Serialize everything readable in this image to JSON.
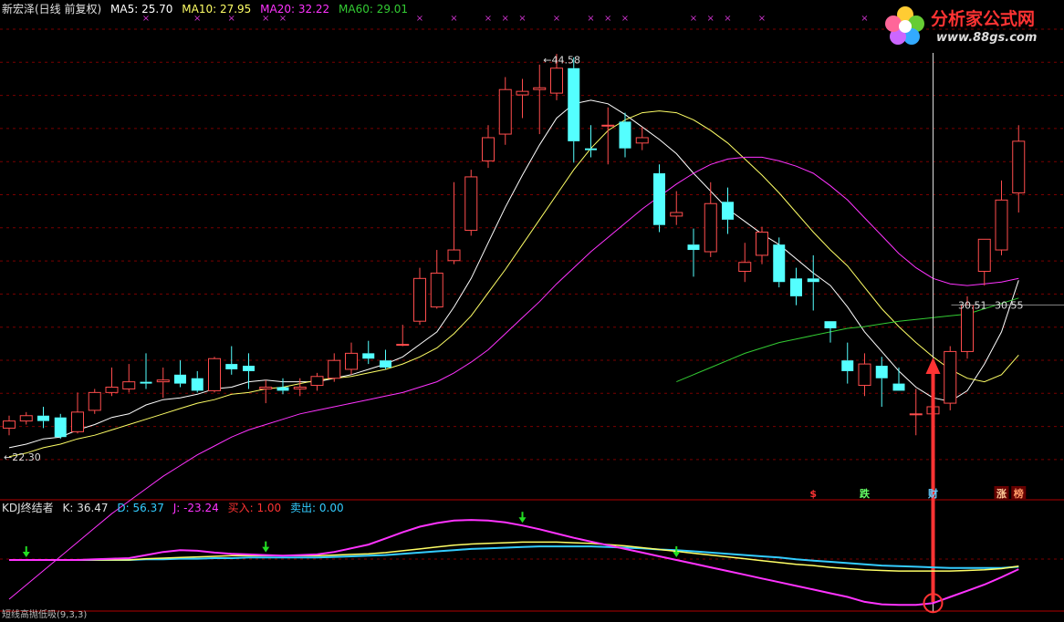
{
  "main_header": {
    "name": "新宏泽(日线 前复权)",
    "ma5": "MA5: 25.70",
    "ma10": "MA10: 27.95",
    "ma20": "MA20: 32.22",
    "ma60": "MA60: 29.01"
  },
  "kdj_header": {
    "name": "KDJ终结者",
    "k": "K: 36.47",
    "d": "D: 56.37",
    "j": "J: -23.24",
    "buy": "买入: 1.00",
    "sell": "卖出: 0.00"
  },
  "bottom_strip_text": "短线高抛低吸(9,3,3)",
  "logo": {
    "title": "分析家公式网",
    "url": "www.88gs.com"
  },
  "annotations": {
    "high": "44.58",
    "low": "22.30",
    "crosshair": "30.51",
    "price_label": "30.55"
  },
  "signal_labels": [
    "$",
    "跌",
    "财",
    "涨",
    "榜"
  ],
  "colors": {
    "bg": "#000000",
    "grid": "#7a0000",
    "up": "#ff4d4d",
    "down": "#54ffff",
    "ma5": "#ffffff",
    "ma10": "#ffff66",
    "ma20": "#ff33ff",
    "ma60": "#33cc33",
    "kdj_k": "#ffff66",
    "kdj_d": "#33ccff",
    "kdj_j": "#ff33ff",
    "arrow": "#ff3333"
  },
  "chart_data": {
    "type": "candlestick",
    "ohlc": [
      [
        23.6,
        24.3,
        23.2,
        24.0
      ],
      [
        24.0,
        24.5,
        23.8,
        24.3
      ],
      [
        24.3,
        24.8,
        23.6,
        24.0
      ],
      [
        24.2,
        24.4,
        23.0,
        23.1
      ],
      [
        23.4,
        25.6,
        23.3,
        24.5
      ],
      [
        24.6,
        25.8,
        24.4,
        25.6
      ],
      [
        25.6,
        27.0,
        25.4,
        25.9
      ],
      [
        25.8,
        27.2,
        25.6,
        26.2
      ],
      [
        26.2,
        27.8,
        25.8,
        26.1
      ],
      [
        26.2,
        27.0,
        25.3,
        26.3
      ],
      [
        26.6,
        27.4,
        25.9,
        26.1
      ],
      [
        26.4,
        26.8,
        25.6,
        25.7
      ],
      [
        25.7,
        27.6,
        25.6,
        27.5
      ],
      [
        27.2,
        28.2,
        26.6,
        26.9
      ],
      [
        27.1,
        27.8,
        25.8,
        26.8
      ],
      [
        25.8,
        26.3,
        25.0,
        25.9
      ],
      [
        25.9,
        26.4,
        25.5,
        25.7
      ],
      [
        25.8,
        26.4,
        25.4,
        25.9
      ],
      [
        26.0,
        26.7,
        25.7,
        26.5
      ],
      [
        26.4,
        27.8,
        26.2,
        27.4
      ],
      [
        26.9,
        28.4,
        26.6,
        27.8
      ],
      [
        27.8,
        28.5,
        27.2,
        27.5
      ],
      [
        27.4,
        28.0,
        26.9,
        27.0
      ],
      [
        28.3,
        29.4,
        28.2,
        28.3
      ],
      [
        29.6,
        32.6,
        29.4,
        32.0
      ],
      [
        30.4,
        33.6,
        30.3,
        32.3
      ],
      [
        33.0,
        37.4,
        32.8,
        33.6
      ],
      [
        34.7,
        38.1,
        34.4,
        37.7
      ],
      [
        38.6,
        40.6,
        38.2,
        39.9
      ],
      [
        40.1,
        43.3,
        39.5,
        42.6
      ],
      [
        42.3,
        43.2,
        41.0,
        42.5
      ],
      [
        42.6,
        44.0,
        40.1,
        42.7
      ],
      [
        42.4,
        44.6,
        42.0,
        43.8
      ],
      [
        43.8,
        44.4,
        38.5,
        39.7
      ],
      [
        39.3,
        40.6,
        38.8,
        39.2
      ],
      [
        40.6,
        41.6,
        38.4,
        40.6
      ],
      [
        40.8,
        41.3,
        38.8,
        39.3
      ],
      [
        39.6,
        40.5,
        39.2,
        39.9
      ],
      [
        37.9,
        38.4,
        34.6,
        35.0
      ],
      [
        35.5,
        36.9,
        35.0,
        35.7
      ],
      [
        33.9,
        34.8,
        32.1,
        33.6
      ],
      [
        33.5,
        37.4,
        33.2,
        36.2
      ],
      [
        36.3,
        37.1,
        34.5,
        35.3
      ],
      [
        32.4,
        34.0,
        31.8,
        32.9
      ],
      [
        33.3,
        34.9,
        32.8,
        34.6
      ],
      [
        33.9,
        34.3,
        31.5,
        31.8
      ],
      [
        32.0,
        32.6,
        30.5,
        31.0
      ],
      [
        32.0,
        33.3,
        30.2,
        31.8
      ],
      [
        29.6,
        29.6,
        28.4,
        29.2
      ],
      [
        27.4,
        28.4,
        26.1,
        26.8
      ],
      [
        26.0,
        27.8,
        25.4,
        27.2
      ],
      [
        27.1,
        27.6,
        24.8,
        26.4
      ],
      [
        26.1,
        27.0,
        25.7,
        25.7
      ],
      [
        24.4,
        25.8,
        23.2,
        24.4
      ],
      [
        24.4,
        25.6,
        24.2,
        24.8
      ],
      [
        25.0,
        28.2,
        24.6,
        27.9
      ],
      [
        27.9,
        31.0,
        27.5,
        30.5
      ],
      [
        32.4,
        34.2,
        31.6,
        34.2
      ],
      [
        33.6,
        37.5,
        33.3,
        36.4
      ],
      [
        36.8,
        40.6,
        35.7,
        39.7
      ]
    ],
    "ma_lines": [
      {
        "name": "MA5",
        "values": [
          22.5,
          22.7,
          23.0,
          23.1,
          23.5,
          23.8,
          24.2,
          24.4,
          24.9,
          25.2,
          25.3,
          25.5,
          25.8,
          25.9,
          26.2,
          26.3,
          26.2,
          26.2,
          26.2,
          26.4,
          26.6,
          26.9,
          27.2,
          27.6,
          28.3,
          29.0,
          30.4,
          32.0,
          34.0,
          36.0,
          37.8,
          39.5,
          41.0,
          41.8,
          42.0,
          41.8,
          41.2,
          40.5,
          39.8,
          39.0,
          37.9,
          36.9,
          35.9,
          35.2,
          34.5,
          33.9,
          33.1,
          32.3,
          31.6,
          30.4,
          29.0,
          27.9,
          26.8,
          25.9,
          25.3,
          25.1,
          25.7,
          27.2,
          29.0,
          31.9
        ]
      },
      {
        "name": "MA10",
        "values": [
          22.0,
          22.2,
          22.5,
          22.7,
          23.0,
          23.2,
          23.5,
          23.8,
          24.1,
          24.4,
          24.7,
          25.0,
          25.2,
          25.5,
          25.6,
          25.8,
          25.9,
          26.1,
          26.3,
          26.4,
          26.5,
          26.7,
          26.9,
          27.2,
          27.6,
          28.1,
          28.9,
          29.9,
          31.2,
          32.5,
          33.9,
          35.3,
          36.7,
          38.1,
          39.3,
          40.3,
          40.9,
          41.3,
          41.4,
          41.3,
          40.9,
          40.3,
          39.6,
          38.7,
          37.8,
          36.8,
          35.7,
          34.6,
          33.6,
          32.7,
          31.5,
          30.3,
          29.3,
          28.4,
          27.6,
          26.9,
          26.4,
          26.2,
          26.6,
          27.7
        ]
      },
      {
        "name": "MA20",
        "values": [
          14.0,
          14.8,
          15.6,
          16.4,
          17.2,
          18.0,
          18.8,
          19.5,
          20.2,
          20.9,
          21.5,
          22.1,
          22.6,
          23.1,
          23.5,
          23.8,
          24.1,
          24.4,
          24.6,
          24.8,
          25.0,
          25.2,
          25.4,
          25.6,
          25.9,
          26.2,
          26.7,
          27.3,
          28.0,
          28.9,
          29.8,
          30.7,
          31.7,
          32.6,
          33.5,
          34.3,
          35.1,
          35.9,
          36.6,
          37.3,
          37.9,
          38.4,
          38.7,
          38.8,
          38.8,
          38.6,
          38.3,
          37.9,
          37.2,
          36.4,
          35.4,
          34.4,
          33.4,
          32.6,
          32.0,
          31.7,
          31.6,
          31.7,
          31.8,
          32.0
        ]
      },
      {
        "name": "MA60",
        "values": [
          null,
          null,
          null,
          null,
          null,
          null,
          null,
          null,
          null,
          null,
          null,
          null,
          null,
          null,
          null,
          null,
          null,
          null,
          null,
          null,
          null,
          null,
          null,
          null,
          null,
          null,
          null,
          null,
          null,
          null,
          null,
          null,
          null,
          null,
          null,
          null,
          null,
          null,
          null,
          26.2,
          26.6,
          27.0,
          27.4,
          27.8,
          28.1,
          28.4,
          28.6,
          28.8,
          29.0,
          29.2,
          29.3,
          29.45,
          29.6,
          29.7,
          29.8,
          29.9,
          30.0,
          30.3,
          30.6,
          30.9
        ]
      }
    ],
    "y_range": [
      20.5,
      46.5
    ],
    "top_markers": [
      8,
      11,
      13,
      15,
      16,
      24,
      26,
      28,
      29,
      30,
      32,
      34,
      35,
      36,
      40,
      41,
      42,
      44,
      50,
      53
    ],
    "kdj": {
      "range": [
        -30,
        130
      ],
      "k": [
        50,
        50,
        50,
        50,
        50,
        50,
        50,
        50,
        52,
        53,
        54,
        55,
        56,
        57,
        57,
        57,
        57,
        57,
        57,
        58,
        59,
        60,
        62,
        65,
        68,
        71,
        74,
        76,
        77,
        78,
        79,
        79,
        79,
        78,
        77,
        75,
        73,
        70,
        67,
        64,
        61,
        58,
        55,
        52,
        49,
        46,
        43,
        41,
        38,
        36,
        34,
        33,
        32,
        32,
        32,
        32,
        33,
        34,
        36,
        40
      ],
      "d": [
        50,
        50,
        50,
        50,
        50,
        50,
        50,
        50,
        51,
        51,
        52,
        52,
        53,
        53,
        54,
        54,
        54,
        54,
        54,
        55,
        56,
        57,
        58,
        60,
        62,
        64,
        66,
        68,
        69,
        70,
        71,
        72,
        72,
        72,
        72,
        71,
        70,
        69,
        67,
        66,
        64,
        62,
        60,
        58,
        56,
        54,
        51,
        49,
        47,
        45,
        43,
        41,
        40,
        39,
        38,
        37,
        37,
        37,
        37,
        39
      ],
      "j": [
        50,
        50,
        50,
        50,
        50,
        51,
        52,
        53,
        58,
        63,
        66,
        65,
        62,
        60,
        59,
        58,
        57,
        58,
        59,
        63,
        69,
        75,
        85,
        95,
        104,
        110,
        114,
        115,
        114,
        111,
        106,
        100,
        93,
        86,
        80,
        74,
        68,
        62,
        56,
        50,
        44,
        38,
        32,
        26,
        20,
        14,
        8,
        2,
        -4,
        -10,
        -18,
        -22,
        -23,
        -23,
        -20,
        -10,
        0,
        10,
        22,
        35
      ],
      "green_arrows": [
        1,
        15,
        30,
        39
      ],
      "buy_signal_index": 54,
      "signal_label_positions": [
        47,
        50,
        54,
        58,
        59
      ]
    }
  }
}
